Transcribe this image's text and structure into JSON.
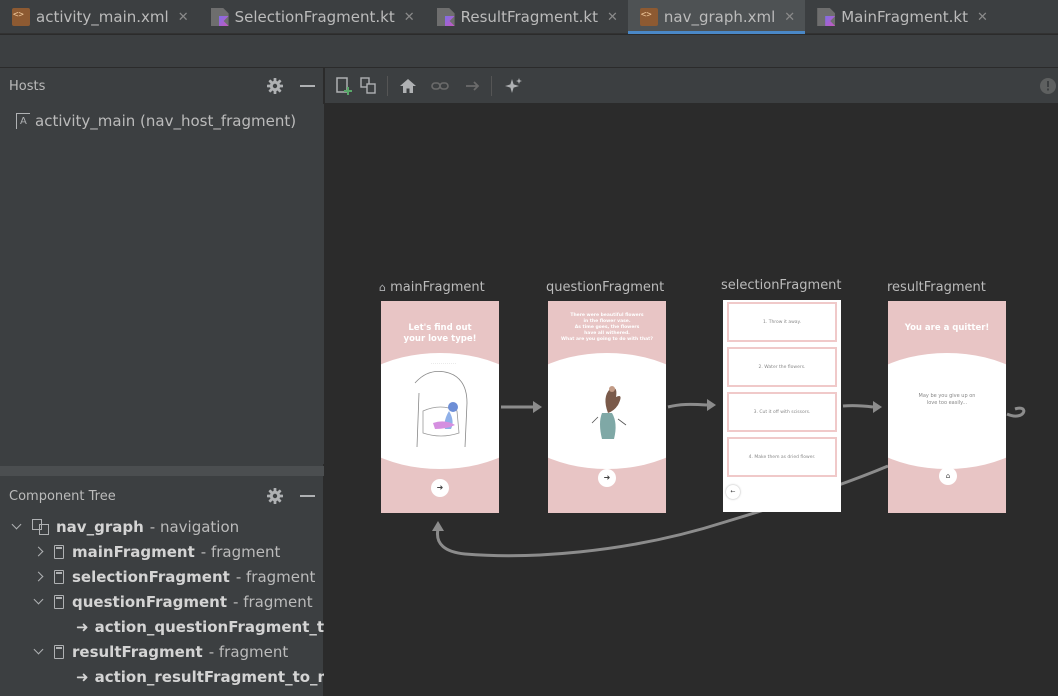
{
  "tabs": [
    {
      "label": "activity_main.xml",
      "type": "xml",
      "active": false
    },
    {
      "label": "SelectionFragment.kt",
      "type": "kt",
      "active": false
    },
    {
      "label": "ResultFragment.kt",
      "type": "kt",
      "active": false
    },
    {
      "label": "nav_graph.xml",
      "type": "xml",
      "active": true
    },
    {
      "label": "MainFragment.kt",
      "type": "kt",
      "active": false
    }
  ],
  "hosts": {
    "title": "Hosts",
    "items": [
      "activity_main (nav_host_fragment)"
    ]
  },
  "component_tree": {
    "title": "Component Tree",
    "root": {
      "name": "nav_graph",
      "kind": "- navigation"
    },
    "rows": [
      {
        "name": "mainFragment",
        "kind": "- fragment"
      },
      {
        "name": "selectionFragment",
        "kind": "- fragment"
      },
      {
        "name": "questionFragment",
        "kind": "- fragment"
      },
      {
        "name": "action_questionFragment_to_selectionFragment"
      },
      {
        "name": "resultFragment",
        "kind": "- fragment"
      },
      {
        "name": "action_resultFragment_to_mainFragment"
      }
    ]
  },
  "toolbar_icons": [
    "new-destination-icon",
    "nested-graph-icon",
    "home-icon",
    "link-icon",
    "action-icon",
    "auto-arrange-icon",
    "info-icon"
  ],
  "fragments": {
    "main": {
      "label": "mainFragment",
      "title": "Let's find out\nyour love type!"
    },
    "question": {
      "label": "questionFragment",
      "text": "There were beautiful flowers\nin the flower vase.\nAs time goes, the flowers\nhave all withered.\nWhat are you going to do with that?"
    },
    "selection": {
      "label": "selectionFragment",
      "options": [
        "1. Throw it away.",
        "2. Water the flowers.",
        "3. Cut it off with scissors.",
        "4. Make them as dried flower."
      ]
    },
    "result": {
      "label": "resultFragment",
      "title": "You are a quitter!",
      "text": "May be you give up on\nlove too easily..."
    }
  },
  "colors": {
    "screen_pink": "#e8c5c5",
    "action_line": "#8c8c8c",
    "tab_underline": "#4a88c7"
  }
}
